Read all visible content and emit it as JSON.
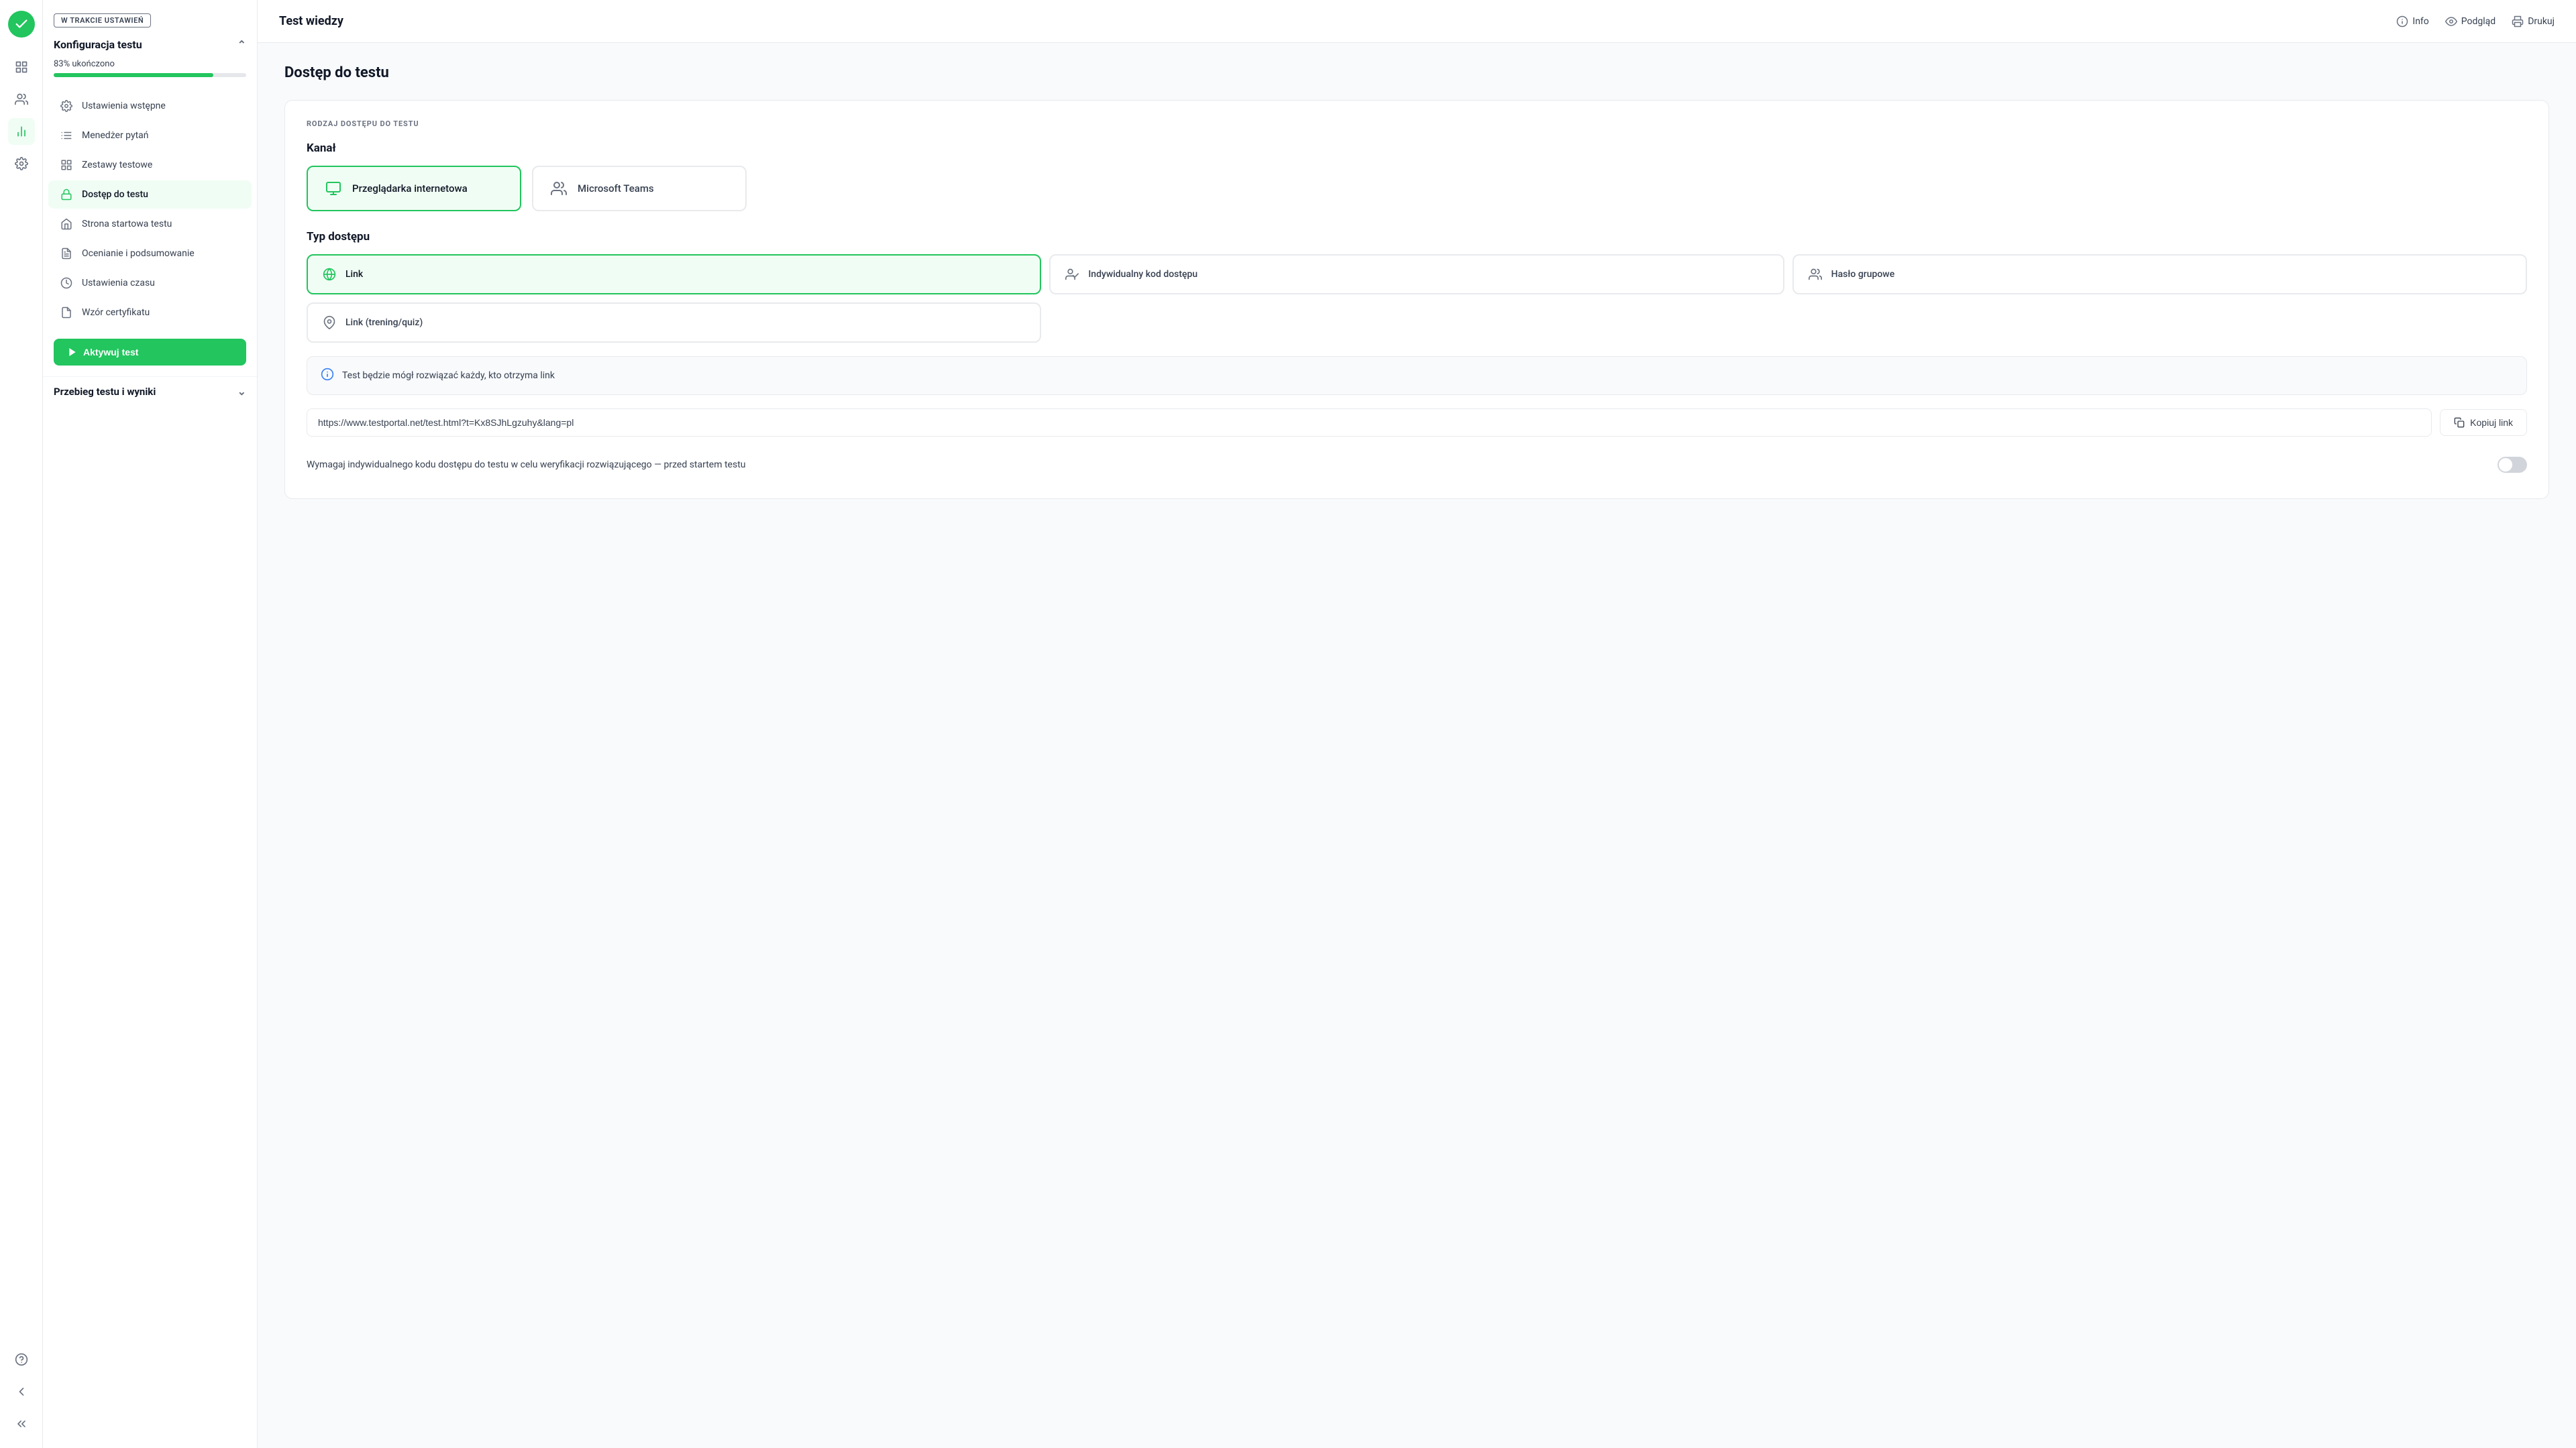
{
  "app": {
    "title": "Test wiedzy"
  },
  "topbar": {
    "title": "Test wiedzy",
    "actions": {
      "info": "Info",
      "preview": "Podgląd",
      "print": "Drukuj"
    }
  },
  "sidebar": {
    "badge": "W TRAKCIE USTAWIEŃ",
    "config_section": "Konfiguracja testu",
    "progress_label": "83% ukończono",
    "progress_percent": 83,
    "nav_items": [
      {
        "id": "ustawienia-wstepne",
        "label": "Ustawienia wstępne",
        "icon": "settings-icon"
      },
      {
        "id": "menedzer-pytan",
        "label": "Menedżer pytań",
        "icon": "questions-icon"
      },
      {
        "id": "zestawy-testowe",
        "label": "Zestawy testowe",
        "icon": "sets-icon"
      },
      {
        "id": "dostep-do-testu",
        "label": "Dostęp do testu",
        "icon": "access-icon",
        "active": true
      },
      {
        "id": "strona-startowa",
        "label": "Strona startowa testu",
        "icon": "start-page-icon"
      },
      {
        "id": "ocenianie",
        "label": "Ocenianie i podsumowanie",
        "icon": "grading-icon"
      },
      {
        "id": "ustawienia-czasu",
        "label": "Ustawienia czasu",
        "icon": "time-icon"
      },
      {
        "id": "wzor-certyfikatu",
        "label": "Wzór certyfikatu",
        "icon": "certificate-icon"
      }
    ],
    "activate_btn": "Aktywuj test",
    "results_section": "Przebieg testu i wyniki"
  },
  "rail": {
    "icons": [
      "home-icon",
      "users-icon",
      "charts-icon",
      "settings-icon",
      "help-icon",
      "back-icon",
      "collapse-icon"
    ]
  },
  "main": {
    "page_title": "Dostęp do testu",
    "access_type_section_label": "RODZAJ DOSTĘPU DO TESTU",
    "channel_label": "Kanał",
    "channel_options": [
      {
        "id": "przegladarka",
        "label": "Przeglądarka internetowa",
        "selected": true
      },
      {
        "id": "teams",
        "label": "Microsoft Teams",
        "selected": false
      }
    ],
    "access_type_label": "Typ dostępu",
    "access_types": [
      {
        "id": "link",
        "label": "Link",
        "selected": true
      },
      {
        "id": "indywidualny-kod",
        "label": "Indywidualny kod dostępu",
        "selected": false
      },
      {
        "id": "haslo-grupowe",
        "label": "Hasło grupowe",
        "selected": false
      },
      {
        "id": "link-trening",
        "label": "Link (trening/quiz)",
        "selected": false
      }
    ],
    "info_box_text": "Test będzie mógł rozwiązać każdy, kto otrzyma link",
    "link_url": "https://www.testportal.net/test.html?t=Kx8SJhLgzuhy&lang=pl",
    "copy_link_label": "Kopiuj link",
    "toggle_row_label": "Wymagaj indywidualnego kodu dostępu do testu w celu weryfikacji rozwiązującego — przed startem testu",
    "toggle_on": false
  }
}
